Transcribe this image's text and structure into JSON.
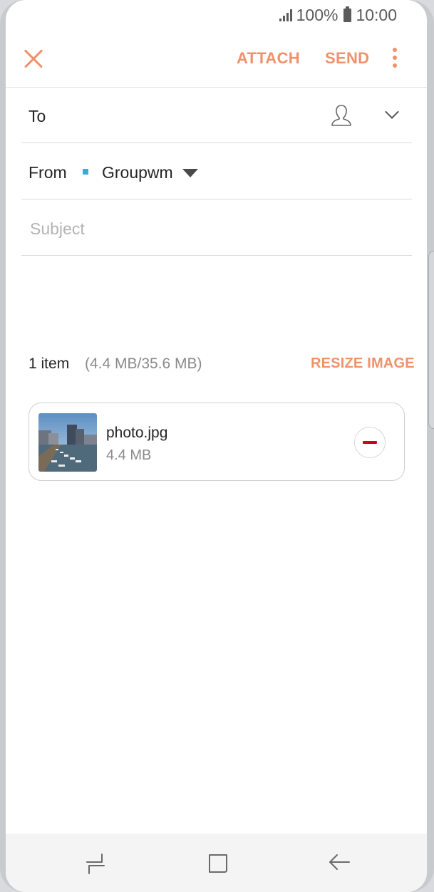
{
  "status_bar": {
    "battery_percent": "100%",
    "time": "10:00"
  },
  "appbar": {
    "attach_label": "ATTACH",
    "send_label": "SEND",
    "close_icon": "close-icon",
    "more_icon": "more-vert-icon"
  },
  "compose": {
    "to_label": "To",
    "from_label": "From",
    "from_account": "Groupwm",
    "subject_placeholder": "Subject"
  },
  "attachments": {
    "item_count": "1 item",
    "size_summary": "(4.4 MB/35.6 MB)",
    "resize_label": "RESIZE IMAGE",
    "files": [
      {
        "name": "photo.jpg",
        "size": "4.4 MB"
      }
    ]
  },
  "colors": {
    "accent": "#f0916a",
    "account_marker": "#3aaad8",
    "remove": "#d0021b"
  },
  "navigation": {
    "icons": [
      "recent-apps-icon",
      "home-icon",
      "back-icon"
    ]
  }
}
